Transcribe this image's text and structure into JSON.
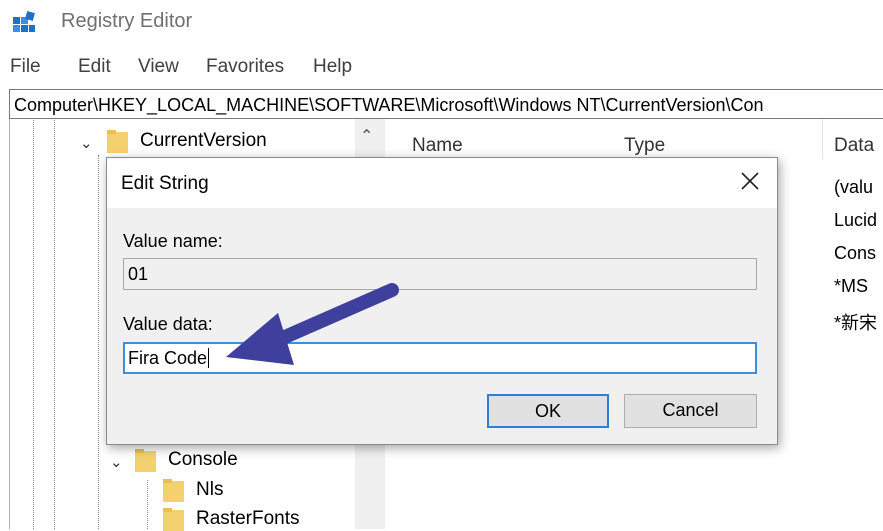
{
  "window": {
    "title": "Registry Editor"
  },
  "menu": [
    "File",
    "Edit",
    "View",
    "Favorites",
    "Help"
  ],
  "address": "Computer\\HKEY_LOCAL_MACHINE\\SOFTWARE\\Microsoft\\Windows NT\\CurrentVersion\\Con",
  "tree": {
    "current_version": "CurrentVersion",
    "console": "Console",
    "nls": "Nls",
    "raster_fonts": "RasterFonts"
  },
  "list": {
    "columns": [
      "Name",
      "Type",
      "Data"
    ],
    "data_cells": [
      "(valu",
      "Lucid",
      "Cons",
      "*MS",
      "*新宋"
    ]
  },
  "dialog": {
    "title": "Edit String",
    "value_name_label": "Value name:",
    "value_name": "01",
    "value_data_label": "Value data:",
    "value_data": "Fira Code",
    "ok": "OK",
    "cancel": "Cancel"
  },
  "colors": {
    "arrow": "#3f3f9e",
    "focus_border": "#3b8fdc",
    "folder": "#f4d06f"
  }
}
